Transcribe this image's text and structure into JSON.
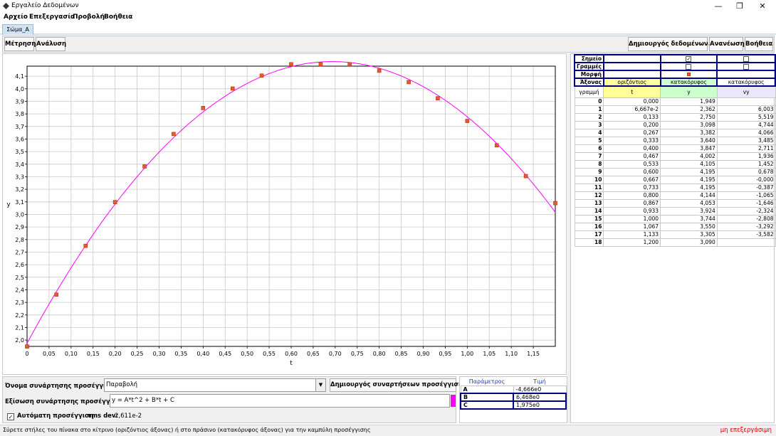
{
  "window": {
    "title": "Εργαλείο Δεδομένων",
    "minimize": "—",
    "maximize": "❐",
    "close": "✕"
  },
  "menu": [
    "Αρχείο",
    "Επεξεργασία",
    "Προβολή",
    "Βοήθεια"
  ],
  "tab": "Σώμα_A",
  "toolbar": {
    "measure": "Μέτρηση",
    "analysis": "Ανάλυση",
    "data_builder": "Δημιουργός δεδομένων...",
    "refresh": "Ανανέωση",
    "help": "Βοήθεια"
  },
  "chart_data": {
    "type": "scatter",
    "xlabel": "t",
    "ylabel": "y",
    "xlim": [
      0,
      1.2
    ],
    "ylim": [
      1.95,
      4.18
    ],
    "xticks": [
      "0",
      "0,05",
      "0,10",
      "0,15",
      "0,20",
      "0,25",
      "0,30",
      "0,35",
      "0,40",
      "0,45",
      "0,50",
      "0,55",
      "0,60",
      "0,65",
      "0,70",
      "0,75",
      "0,80",
      "0,85",
      "0,90",
      "0,95",
      "1,00",
      "1,05",
      "1,10",
      "1,15"
    ],
    "yticks": [
      "2,0",
      "2,1",
      "2,2",
      "2,3",
      "2,4",
      "2,5",
      "2,6",
      "2,7",
      "2,8",
      "2,9",
      "3,0",
      "3,1",
      "3,2",
      "3,3",
      "3,4",
      "3,5",
      "3,6",
      "3,7",
      "3,8",
      "3,9",
      "4,0",
      "4,1"
    ],
    "grid": true,
    "points": {
      "x": [
        0,
        0.0667,
        0.133,
        0.2,
        0.267,
        0.333,
        0.4,
        0.467,
        0.533,
        0.6,
        0.667,
        0.733,
        0.8,
        0.867,
        0.933,
        1.0,
        1.067,
        1.133,
        1.2
      ],
      "y": [
        1.949,
        2.362,
        2.75,
        3.098,
        3.382,
        3.64,
        3.847,
        4.002,
        4.105,
        4.195,
        4.195,
        4.195,
        4.144,
        4.053,
        3.924,
        3.744,
        3.55,
        3.305,
        3.09
      ]
    },
    "fit": {
      "A": -4.666,
      "B": 6.468,
      "C": 1.975
    },
    "colors": {
      "point": "#e85a2a",
      "fit": "#ff00ff",
      "grid": "#c8c8c8"
    }
  },
  "table": {
    "row_labels": [
      "Σημείο",
      "Γραμμές",
      "Μορφή",
      "Άξονας"
    ],
    "axis_values": [
      "οριζόντιος",
      "κατακόρυφος",
      "κατακόρυφος"
    ],
    "row_header": "γραμμή",
    "columns": [
      "t",
      "y",
      "vy"
    ],
    "rows": [
      [
        "0",
        "0,000",
        "1,949",
        ""
      ],
      [
        "1",
        "6,667e-2",
        "2,362",
        "6,003"
      ],
      [
        "2",
        "0,133",
        "2,750",
        "5,519"
      ],
      [
        "3",
        "0,200",
        "3,098",
        "4,744"
      ],
      [
        "4",
        "0,267",
        "3,382",
        "4,066"
      ],
      [
        "5",
        "0,333",
        "3,640",
        "3,485"
      ],
      [
        "6",
        "0,400",
        "3,847",
        "2,711"
      ],
      [
        "7",
        "0,467",
        "4,002",
        "1,936"
      ],
      [
        "8",
        "0,533",
        "4,105",
        "1,452"
      ],
      [
        "9",
        "0,600",
        "4,195",
        "0,678"
      ],
      [
        "10",
        "0,667",
        "4,195",
        "-0,000"
      ],
      [
        "11",
        "0,733",
        "4,195",
        "-0,387"
      ],
      [
        "12",
        "0,800",
        "4,144",
        "-1,065"
      ],
      [
        "13",
        "0,867",
        "4,053",
        "-1,646"
      ],
      [
        "14",
        "0,933",
        "3,924",
        "-2,324"
      ],
      [
        "15",
        "1,000",
        "3,744",
        "-2,808"
      ],
      [
        "16",
        "1,067",
        "3,550",
        "-3,292"
      ],
      [
        "17",
        "1,133",
        "3,305",
        "-3,582"
      ],
      [
        "18",
        "1,200",
        "3,090",
        ""
      ]
    ],
    "colors": {
      "t_header": "#ffff99",
      "y_header": "#ccffcc",
      "vy_header": "#e8e8f8",
      "axis_h": "#ffff99",
      "axis_v": "#ccffcc"
    }
  },
  "fit": {
    "name_label": "Όνομα συνάρτησης προσέγγισης:",
    "name_value": "Παραβολή",
    "builder_button": "Δημιουργός συναρτήσεων προσέγγισης...",
    "equation_label": "Εξίσωση συνάρτησης προσέγγισης:",
    "equation_value": "y = A*t^2 + B*t + C",
    "auto_label": "Αυτόματη προσέγγιση",
    "rms_label": "rms dev:",
    "rms_value": "2,611e-2"
  },
  "params": {
    "header_param": "Παράμετρος",
    "header_value": "Τιμή",
    "rows": [
      [
        "A",
        "-4,666e0"
      ],
      [
        "B",
        "6,468e0"
      ],
      [
        "C",
        "1,975e0"
      ]
    ]
  },
  "status": {
    "hint": "Σύρετε στήλες του πίνακα στο κίτρινο (οριζόντιος άξονας) ή στο πράσινο (κατακόρυφος άξονας) για την καμπύλη προσέγγισης",
    "edit_state": "μη επεξεργάσιμη"
  }
}
